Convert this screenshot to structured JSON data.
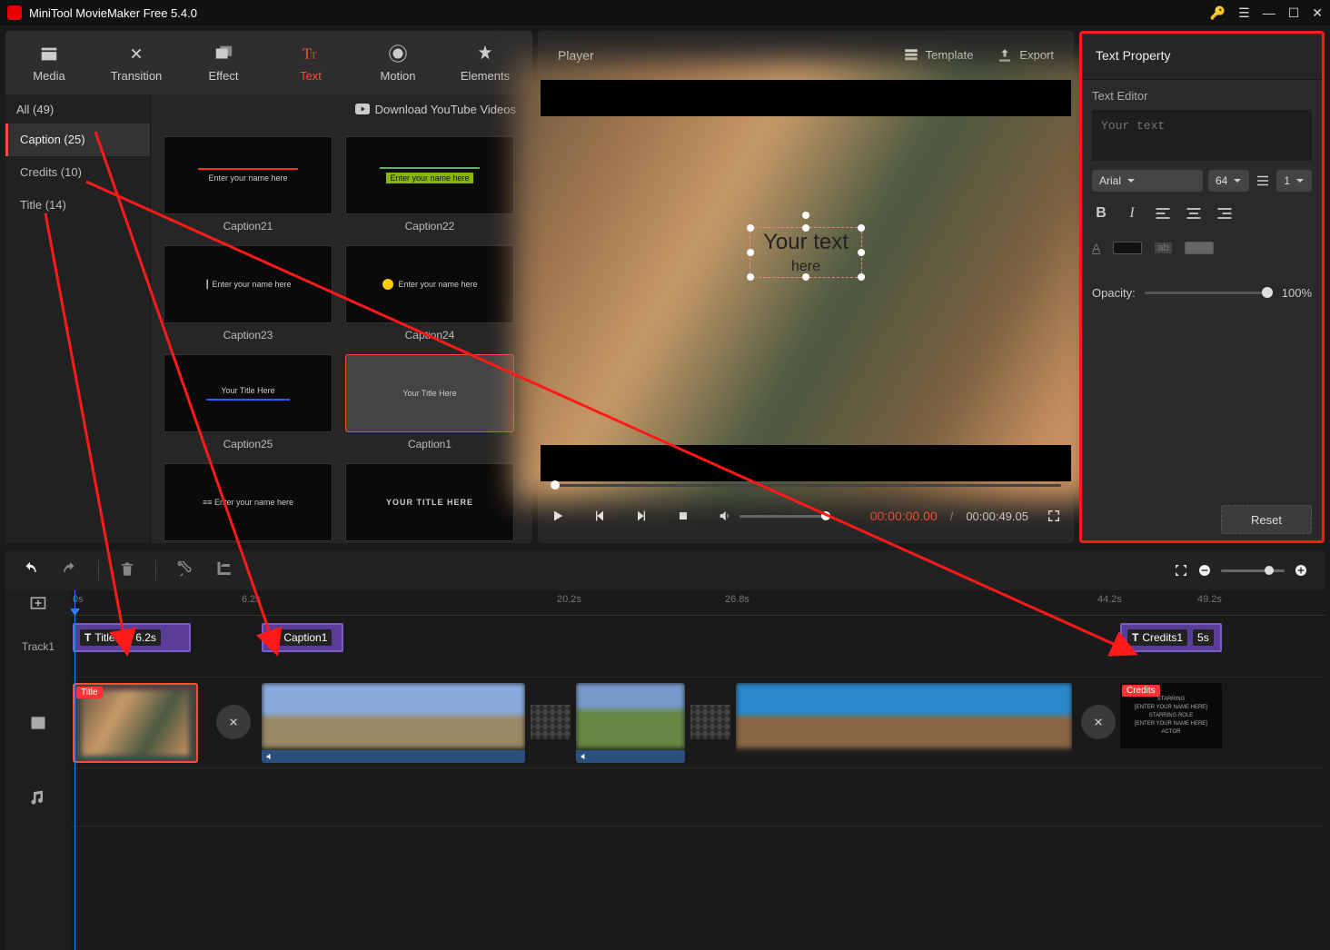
{
  "titlebar": {
    "title": "MiniTool MovieMaker Free 5.4.0"
  },
  "tabs": {
    "media": "Media",
    "transition": "Transition",
    "effect": "Effect",
    "text": "Text",
    "motion": "Motion",
    "elements": "Elements"
  },
  "library": {
    "all": "All (49)",
    "caption": "Caption (25)",
    "credits": "Credits (10)",
    "title": "Title (14)",
    "youtube": "Download YouTube Videos",
    "thumbs": {
      "c21": "Caption21",
      "c22": "Caption22",
      "c23": "Caption23",
      "c24": "Caption24",
      "c25": "Caption25",
      "c1": "Caption1"
    },
    "sample": {
      "entername": "Enter your name here",
      "yourtitle": "Your Title Here",
      "yourtitleh": "Your  Title Here",
      "bigtitle": "YOUR TITLE HERE"
    }
  },
  "player": {
    "label": "Player",
    "template": "Template",
    "export": "Export",
    "preview_text_l1": "Your text",
    "preview_text_l2": "here",
    "time_cur": "00:00:00.00",
    "time_tot": "00:00:49.05"
  },
  "prop": {
    "title": "Text Property",
    "editor": "Text Editor",
    "placeholder": "Your text",
    "font": "Arial",
    "size": "64",
    "line": "1",
    "opacity_label": "Opacity:",
    "opacity_val": "100%",
    "reset": "Reset"
  },
  "timeline": {
    "ticks": {
      "t0": "0s",
      "t1": "6.2s",
      "t2": "20.2s",
      "t3": "26.8s",
      "t4": "44.2s",
      "t5": "49.2s"
    },
    "track1": "Track1",
    "clips": {
      "title1": "Title1",
      "title1_dur": "6.2s",
      "caption1": "Caption1",
      "credits1": "Credits1",
      "credits1_dur": "5s",
      "titletag": "Title",
      "creditstag": "Credits"
    },
    "credits_lines": {
      "a": "STARRING",
      "b": "[ENTER YOUR NAME HERE]",
      "c": "STARRING ROLE",
      "d": "[ENTER YOUR NAME HERE]",
      "e": "ACTOR"
    }
  }
}
